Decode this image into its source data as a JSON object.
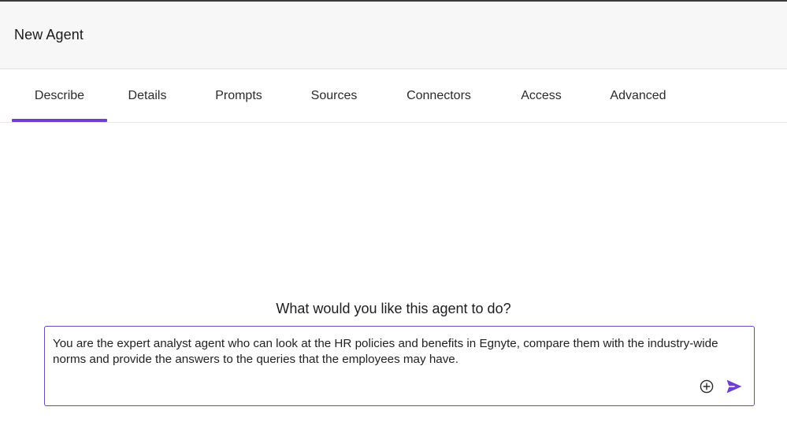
{
  "header": {
    "title": "New Agent"
  },
  "tabs": [
    {
      "label": "Describe",
      "active": true
    },
    {
      "label": "Details",
      "active": false
    },
    {
      "label": "Prompts",
      "active": false
    },
    {
      "label": "Sources",
      "active": false
    },
    {
      "label": "Connectors",
      "active": false
    },
    {
      "label": "Access",
      "active": false
    },
    {
      "label": "Advanced",
      "active": false
    }
  ],
  "describe": {
    "heading": "What would you like this agent to do?",
    "input_value": "You are the expert analyst agent who can look at the HR policies and benefits in Egnyte, compare them with the industry-wide norms and provide the answers to the queries that the employees may have.",
    "attach_icon": "plus-circle-icon",
    "send_icon": "send-icon"
  },
  "colors": {
    "accent": "#6f3fd1",
    "header_bg": "#f7f7f7",
    "text": "#1f1f1f"
  }
}
